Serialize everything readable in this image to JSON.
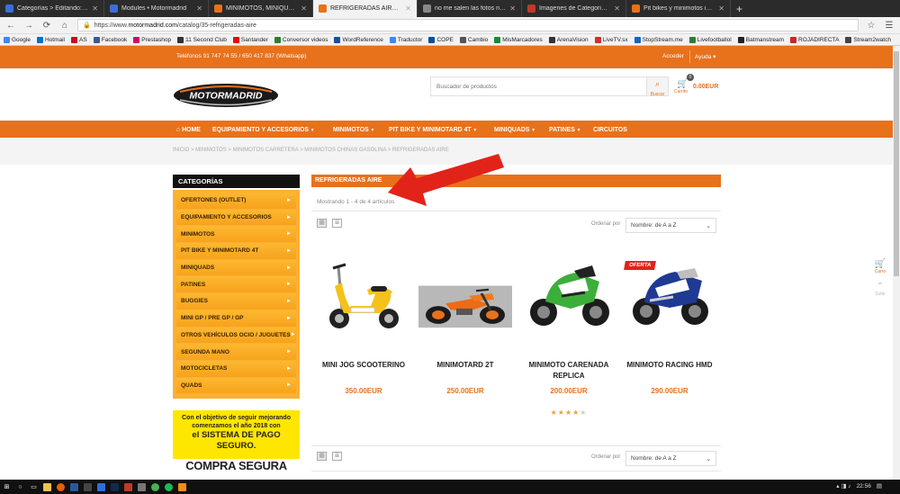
{
  "browser": {
    "tabs": [
      {
        "title": "Categorías > Editando: REFRIGERAD",
        "color": "#3a6fd8",
        "active": false
      },
      {
        "title": "Modules • Motormadrid",
        "color": "#3a6fd8",
        "active": false
      },
      {
        "title": "MINIMOTOS, MINIQUADS, PIT",
        "color": "#e8711c",
        "active": false
      },
      {
        "title": "REFRIGERADAS AIRE - Motorm",
        "color": "#e8711c",
        "active": true
      },
      {
        "title": "no me salen las fotos ni descrip",
        "color": "#888888",
        "active": false
      },
      {
        "title": "Imagenes de Categorias en Pre",
        "color": "#c0392b",
        "active": false
      },
      {
        "title": "Pit bikes y minimotos infantile",
        "color": "#e8711c",
        "active": false
      }
    ],
    "url_prefix": "https://www.",
    "url_host": "motormadrid.com",
    "url_path": "/catalog/35-refrigeradas-aire",
    "bookmarks": [
      {
        "label": "Google",
        "color": "#4285f4"
      },
      {
        "label": "Hotmail",
        "color": "#0072c6"
      },
      {
        "label": "AS",
        "color": "#d0021b"
      },
      {
        "label": "Facebook",
        "color": "#3b5998"
      },
      {
        "label": "Prestashop",
        "color": "#df0067"
      },
      {
        "label": "11 Second Club",
        "color": "#333333"
      },
      {
        "label": "Santander",
        "color": "#ec0000"
      },
      {
        "label": "Conversor videos",
        "color": "#2e7d32"
      },
      {
        "label": "WordReference",
        "color": "#1a4ea1"
      },
      {
        "label": "Traductor",
        "color": "#4285f4"
      },
      {
        "label": "COPE",
        "color": "#0050a0"
      },
      {
        "label": "Cambio",
        "color": "#555555"
      },
      {
        "label": "MisMarcadores",
        "color": "#1b8a3a"
      },
      {
        "label": "ArenaVision",
        "color": "#333333"
      },
      {
        "label": "LiveTV.sx",
        "color": "#d32f2f"
      },
      {
        "label": "StopStream.me",
        "color": "#1565c0"
      },
      {
        "label": "Livefootballol",
        "color": "#2e7d32"
      },
      {
        "label": "Batmanstream",
        "color": "#222222"
      },
      {
        "label": "ROJADIRECTA",
        "color": "#c62828"
      },
      {
        "label": "Stream2watch",
        "color": "#444444"
      }
    ]
  },
  "site": {
    "phone": "Teléfonos 91 747 74 55 / 650 417 837 (Whatsapp)",
    "login": "Acceder",
    "help": "Ayuda",
    "search_placeholder": "Buscador de productos",
    "search_label": "Buscar",
    "cart_label": "Carrito",
    "cart_count": "0",
    "cart_amount": "0.00EUR",
    "logo_text": "MOTORMADRID",
    "menu": [
      {
        "label": "HOME",
        "caret": false
      },
      {
        "label": "EQUIPAMIENTO Y ACCESORIOS",
        "caret": true
      },
      {
        "label": "MINIMOTOS",
        "caret": true
      },
      {
        "label": "PIT BIKE Y MINIMOTARD 4T",
        "caret": true
      },
      {
        "label": "MINIQUADS",
        "caret": true
      },
      {
        "label": "PATINES",
        "caret": true
      },
      {
        "label": "CIRCUITOS",
        "caret": false
      }
    ],
    "breadcrumb": "INICIO > MINIMOTOS > MINIMOTOS CARRETERA > MINIMOTOS CHINAS GASOLINA > REFRIGERADAS AIRE",
    "sidebar_title": "CATEGORÍAS",
    "categories": [
      "OFERTONES (OUTLET)",
      "EQUIPAMIENTO Y ACCESORIOS",
      "MINIMOTOS",
      "PIT BIKE Y MINIMOTARD 4T",
      "MINIQUADS",
      "PATINES",
      "BUGGIES",
      "MINI GP / PRE GP / GP",
      "OTROS VEHÍCULOS OCIO / JUGUETES",
      "SEGUNDA MANO",
      "MOTOCICLETAS",
      "QUADS"
    ],
    "promo_line1": "Con el objetivo de seguir mejorando",
    "promo_line2": "comenzamos el año 2018 con",
    "promo_line3": "el SISTEMA DE PAGO SEGURO.",
    "secure": "COMPRA SEGURA",
    "section_title": "REFRIGERADAS AIRE",
    "showing": "Mostrando 1 - 4 de 4 artículos",
    "sort_label": "Ordenar por",
    "sort_value": "Nombre: de A a Z",
    "products": [
      {
        "name": "MINI JOG SCOOTERINO",
        "price": "350.00EUR",
        "offer": false,
        "rating": 0
      },
      {
        "name": "MINIMOTARD 2T",
        "price": "250.00EUR",
        "offer": false,
        "rating": 0
      },
      {
        "name": "MINIMOTO CARENADA REPLICA",
        "price": "200.00EUR",
        "offer": false,
        "rating": 4
      },
      {
        "name": "MINIMOTO RACING HMD",
        "price": "290.00EUR",
        "offer": true,
        "offer_label": "OFERTA",
        "rating": 0
      }
    ],
    "side_cart_label": "Carro",
    "side_top_label": "Subir"
  },
  "taskbar": {
    "time": "22:56"
  },
  "colors": {
    "accent": "#e8711c",
    "category_yellow": "#fbb034",
    "promo_yellow": "#ffe600",
    "arrow_red": "#e2231a"
  }
}
